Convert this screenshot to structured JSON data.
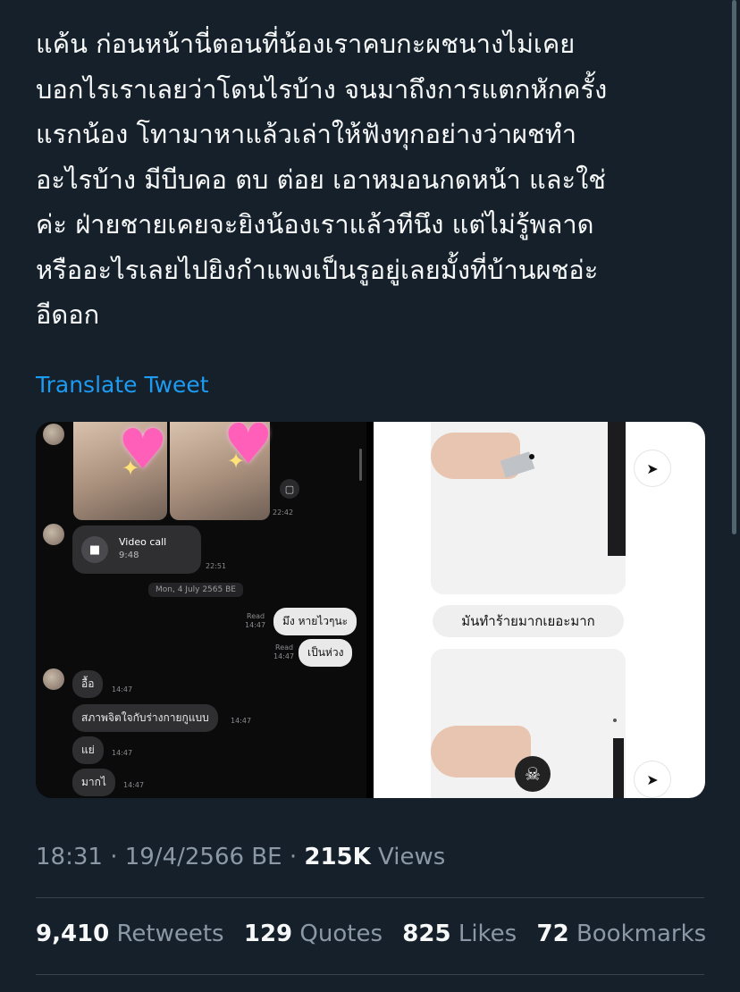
{
  "tweet": {
    "lines": [
      "แค้น ก่อนหน้านี่ตอนที่น้องเราคบกะผชนางไม่เคย",
      "บอกไรเราเลยว่าโดนไรบ้าง จนมาถึงการแตกหักครั้ง",
      "แรกน้อง โทามาหาแล้วเล่าให้ฟังทุกอย่างว่าผชทำ",
      "อะไรบ้าง มีบีบคอ ตบ ต่อย เอาหมอนกดหน้า และใช่",
      "ค่ะ ฝ่ายชายเคยจะยิงน้องเราแล้วทีนึง แต่ไม่รู้พลาด",
      "หรืออะไรเลยไปยิงกำแพงเป็นรูอยู่เลยมั้งที่บ้านผชอ่ะ",
      "อีดอก"
    ],
    "translate_label": "Translate Tweet"
  },
  "media_left": {
    "time_1": "22:42",
    "video_call_title": "Video call",
    "video_call_duration": "9:48",
    "time_2": "22:51",
    "date_label": "Mon, 4 July 2565 BE",
    "read_label_1": "Read",
    "read_time_1": "14:47",
    "out_msg_1": "มึง หายไวๆนะ",
    "read_label_2": "Read",
    "read_time_2": "14:47",
    "out_msg_2": "เป็นห่วง",
    "in_msg_1": "อื้อ",
    "in_time_1": "14:47",
    "in_msg_2": "สภาพจิตใจกับร่างกายกูแบบ",
    "in_time_2": "14:47",
    "in_msg_3": "แย่",
    "in_time_3": "14:47",
    "in_msg_4": "มากไ",
    "in_time_4": "14:47"
  },
  "media_right": {
    "caption": "มันทำร้ายมากเยอะมาก"
  },
  "meta": {
    "time_date": "18:31 · 19/4/2566 BE ·",
    "views_count": "215K",
    "views_label": "Views"
  },
  "stats": {
    "retweets_count": "9,410",
    "retweets_label": "Retweets",
    "quotes_count": "129",
    "quotes_label": "Quotes",
    "likes_count": "825",
    "likes_label": "Likes",
    "bookmarks_count": "72",
    "bookmarks_label": "Bookmarks"
  },
  "icons": {
    "send": "send-icon",
    "video": "video-camera-icon"
  }
}
